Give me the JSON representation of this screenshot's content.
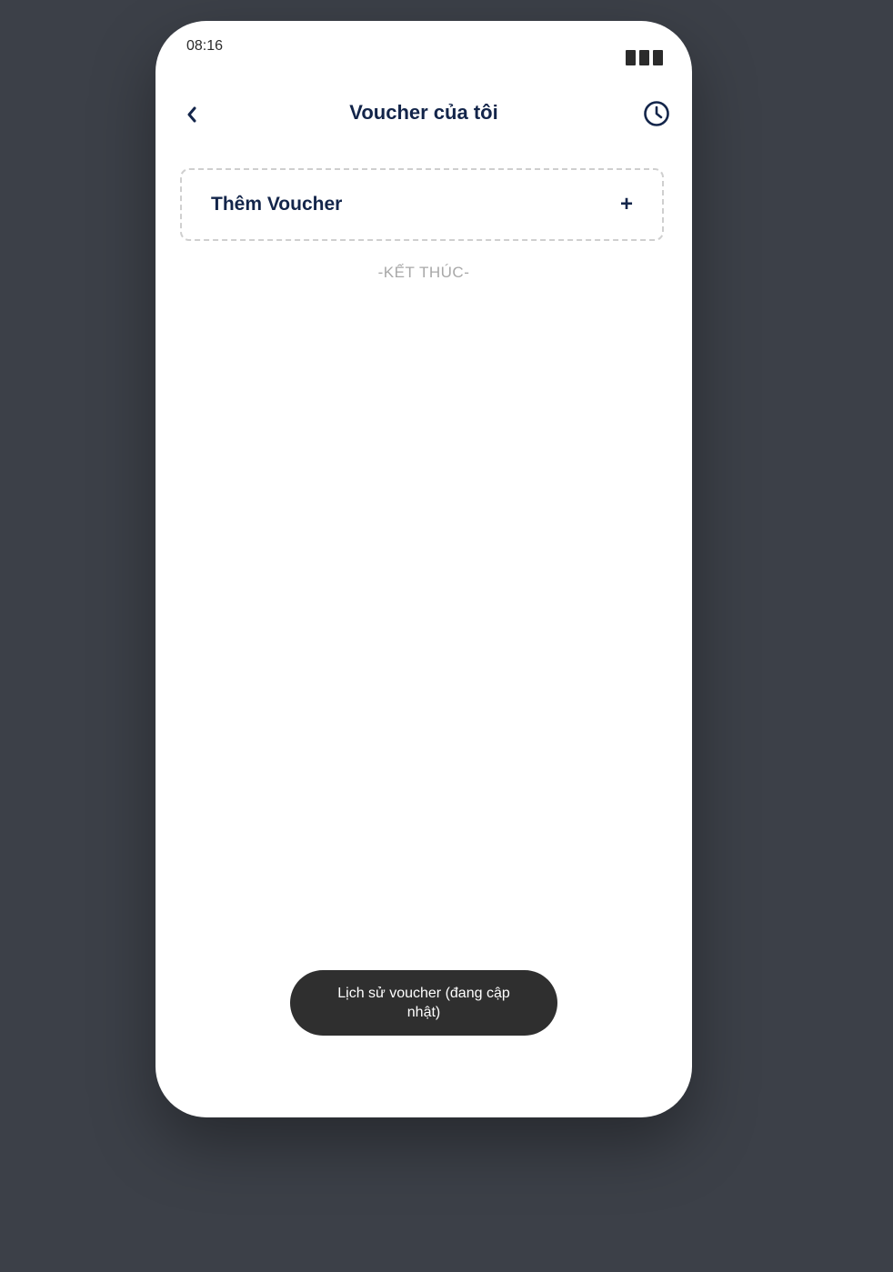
{
  "status_bar": {
    "time": "08:16",
    "battery_icon": "battery-icon"
  },
  "header": {
    "back_icon": "chevron-left-icon",
    "back_glyph": "‹",
    "title": "Voucher của tôi",
    "history_icon": "clock-icon"
  },
  "add_voucher": {
    "label": "Thêm Voucher",
    "plus": "+"
  },
  "list": {
    "end_text": "-KẾT THÚC-"
  },
  "footer": {
    "history_button_label": "Lịch sử voucher (đang cập nhật)"
  },
  "colors": {
    "background": "#3c4048",
    "primary_text": "#13254a",
    "muted_text": "#a8a8a8",
    "pill_bg": "#2f2f2f"
  }
}
